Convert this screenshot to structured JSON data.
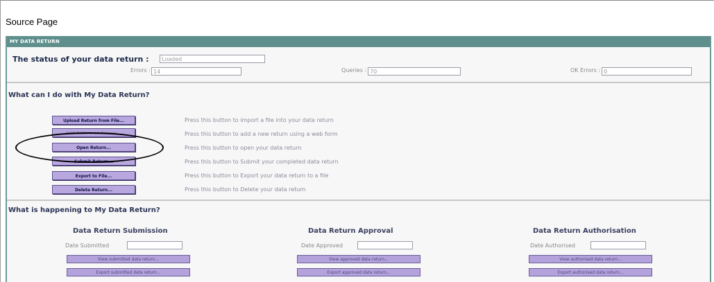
{
  "page_title": "Source Page",
  "panel": {
    "header": "MY DATA RETURN",
    "status_label": "The status of your data return :",
    "status_value": "Loaded",
    "errors_label": "Errors :",
    "errors_value": "14",
    "queries_label": "Queries :",
    "queries_value": "70",
    "ok_errors_label": "OK Errors :",
    "ok_errors_value": "0"
  },
  "actions_section": {
    "title": "What can I do with My Data Return?",
    "actions": [
      {
        "label": "Upload Return from File...",
        "description": "Press this button to import a file into your data return"
      },
      {
        "label": "Add Return on Screen...",
        "description": "Press this button to add a new return using a web form"
      },
      {
        "label": "Open Return...",
        "description": "Press this button to open your data return"
      },
      {
        "label": "Submit Return...",
        "description": "Press this button to Submit your completed data return"
      },
      {
        "label": "Export to File...",
        "description": "Press this button to Export your data return to a file"
      },
      {
        "label": "Delete Return...",
        "description": "Press this button to Delete your data return"
      }
    ]
  },
  "happening_section": {
    "title": "What is happening to My Data Return?",
    "columns": [
      {
        "heading": "Data Return Submission",
        "date_label": "Date Submitted",
        "date_value": "",
        "view_button": "View submitted data return...",
        "export_button": "Export submitted data return..."
      },
      {
        "heading": "Data Return Approval",
        "date_label": "Date Approved",
        "date_value": "",
        "view_button": "View approved data return...",
        "export_button": "Export approved data return..."
      },
      {
        "heading": "Data Return Authorisation",
        "date_label": "Date Authorised",
        "date_value": "",
        "view_button": "View authorised data return...",
        "export_button": "Export authorised data return..."
      }
    ]
  }
}
